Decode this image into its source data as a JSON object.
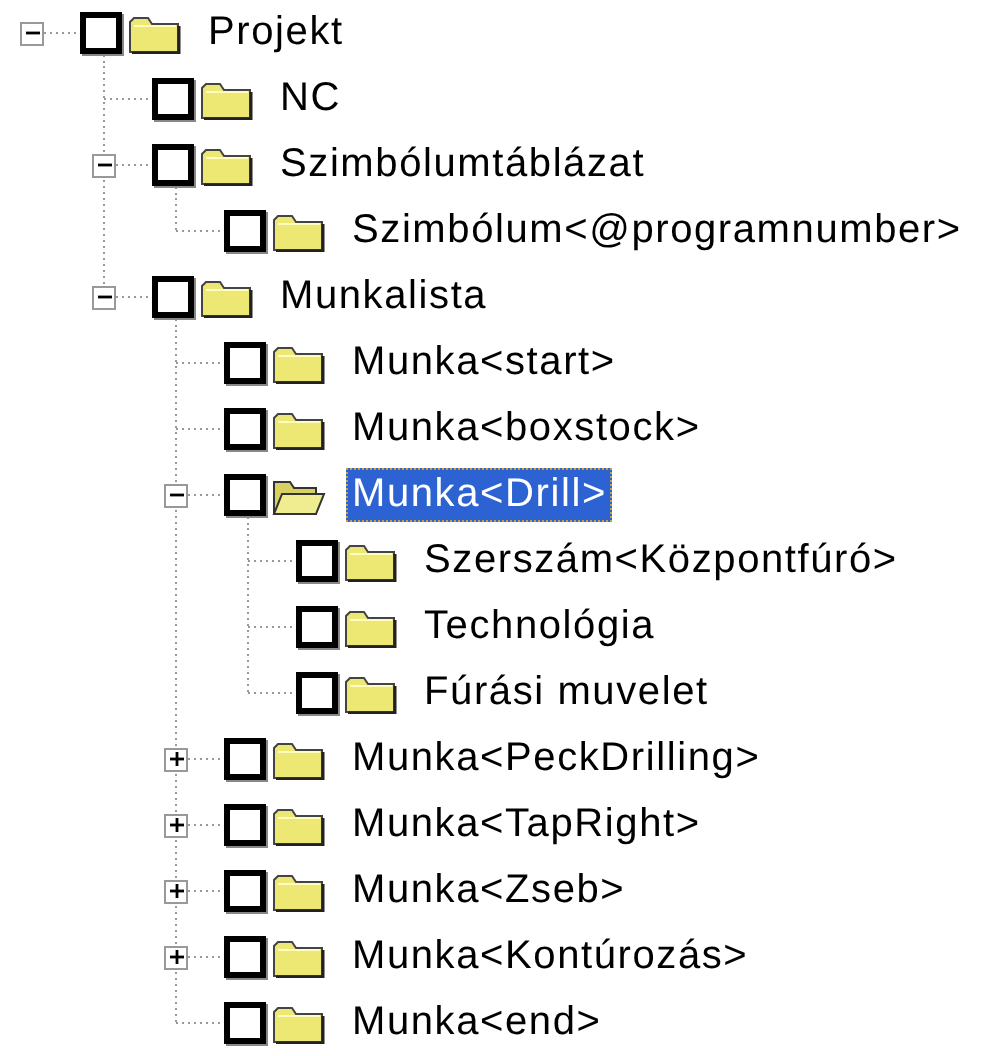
{
  "tree": [
    {
      "label": "Projekt",
      "kind": "branch",
      "expanded": true,
      "checked": false,
      "selected": false,
      "children": [
        {
          "label": "NC",
          "kind": "leaf",
          "checked": false,
          "selected": false
        },
        {
          "label": "Szimbólumtáblázat",
          "kind": "branch",
          "expanded": true,
          "checked": false,
          "selected": false,
          "children": [
            {
              "label": "Szimbólum<@programnumber>",
              "kind": "leaf",
              "checked": false,
              "selected": false
            }
          ]
        },
        {
          "label": "Munkalista",
          "kind": "branch",
          "expanded": true,
          "checked": false,
          "selected": false,
          "children": [
            {
              "label": "Munka<start>",
              "kind": "leaf",
              "checked": false,
              "selected": false
            },
            {
              "label": "Munka<boxstock>",
              "kind": "leaf",
              "checked": false,
              "selected": false
            },
            {
              "label": "Munka<Drill>",
              "kind": "branch",
              "expanded": true,
              "checked": false,
              "selected": true,
              "children": [
                {
                  "label": "Szerszám<Központfúró>",
                  "kind": "leaf",
                  "checked": false,
                  "selected": false
                },
                {
                  "label": "Technológia",
                  "kind": "leaf",
                  "checked": false,
                  "selected": false
                },
                {
                  "label": "Fúrási muvelet",
                  "kind": "leaf",
                  "checked": false,
                  "selected": false
                }
              ]
            },
            {
              "label": "Munka<PeckDrilling>",
              "kind": "branch",
              "expanded": false,
              "checked": false,
              "selected": false
            },
            {
              "label": "Munka<TapRight>",
              "kind": "branch",
              "expanded": false,
              "checked": false,
              "selected": false
            },
            {
              "label": "Munka<Zseb>",
              "kind": "branch",
              "expanded": false,
              "checked": false,
              "selected": false
            },
            {
              "label": "Munka<Kontúrozás>",
              "kind": "branch",
              "expanded": false,
              "checked": false,
              "selected": false
            },
            {
              "label": "Munka<end>",
              "kind": "leaf",
              "checked": false,
              "selected": false
            }
          ]
        }
      ]
    }
  ]
}
